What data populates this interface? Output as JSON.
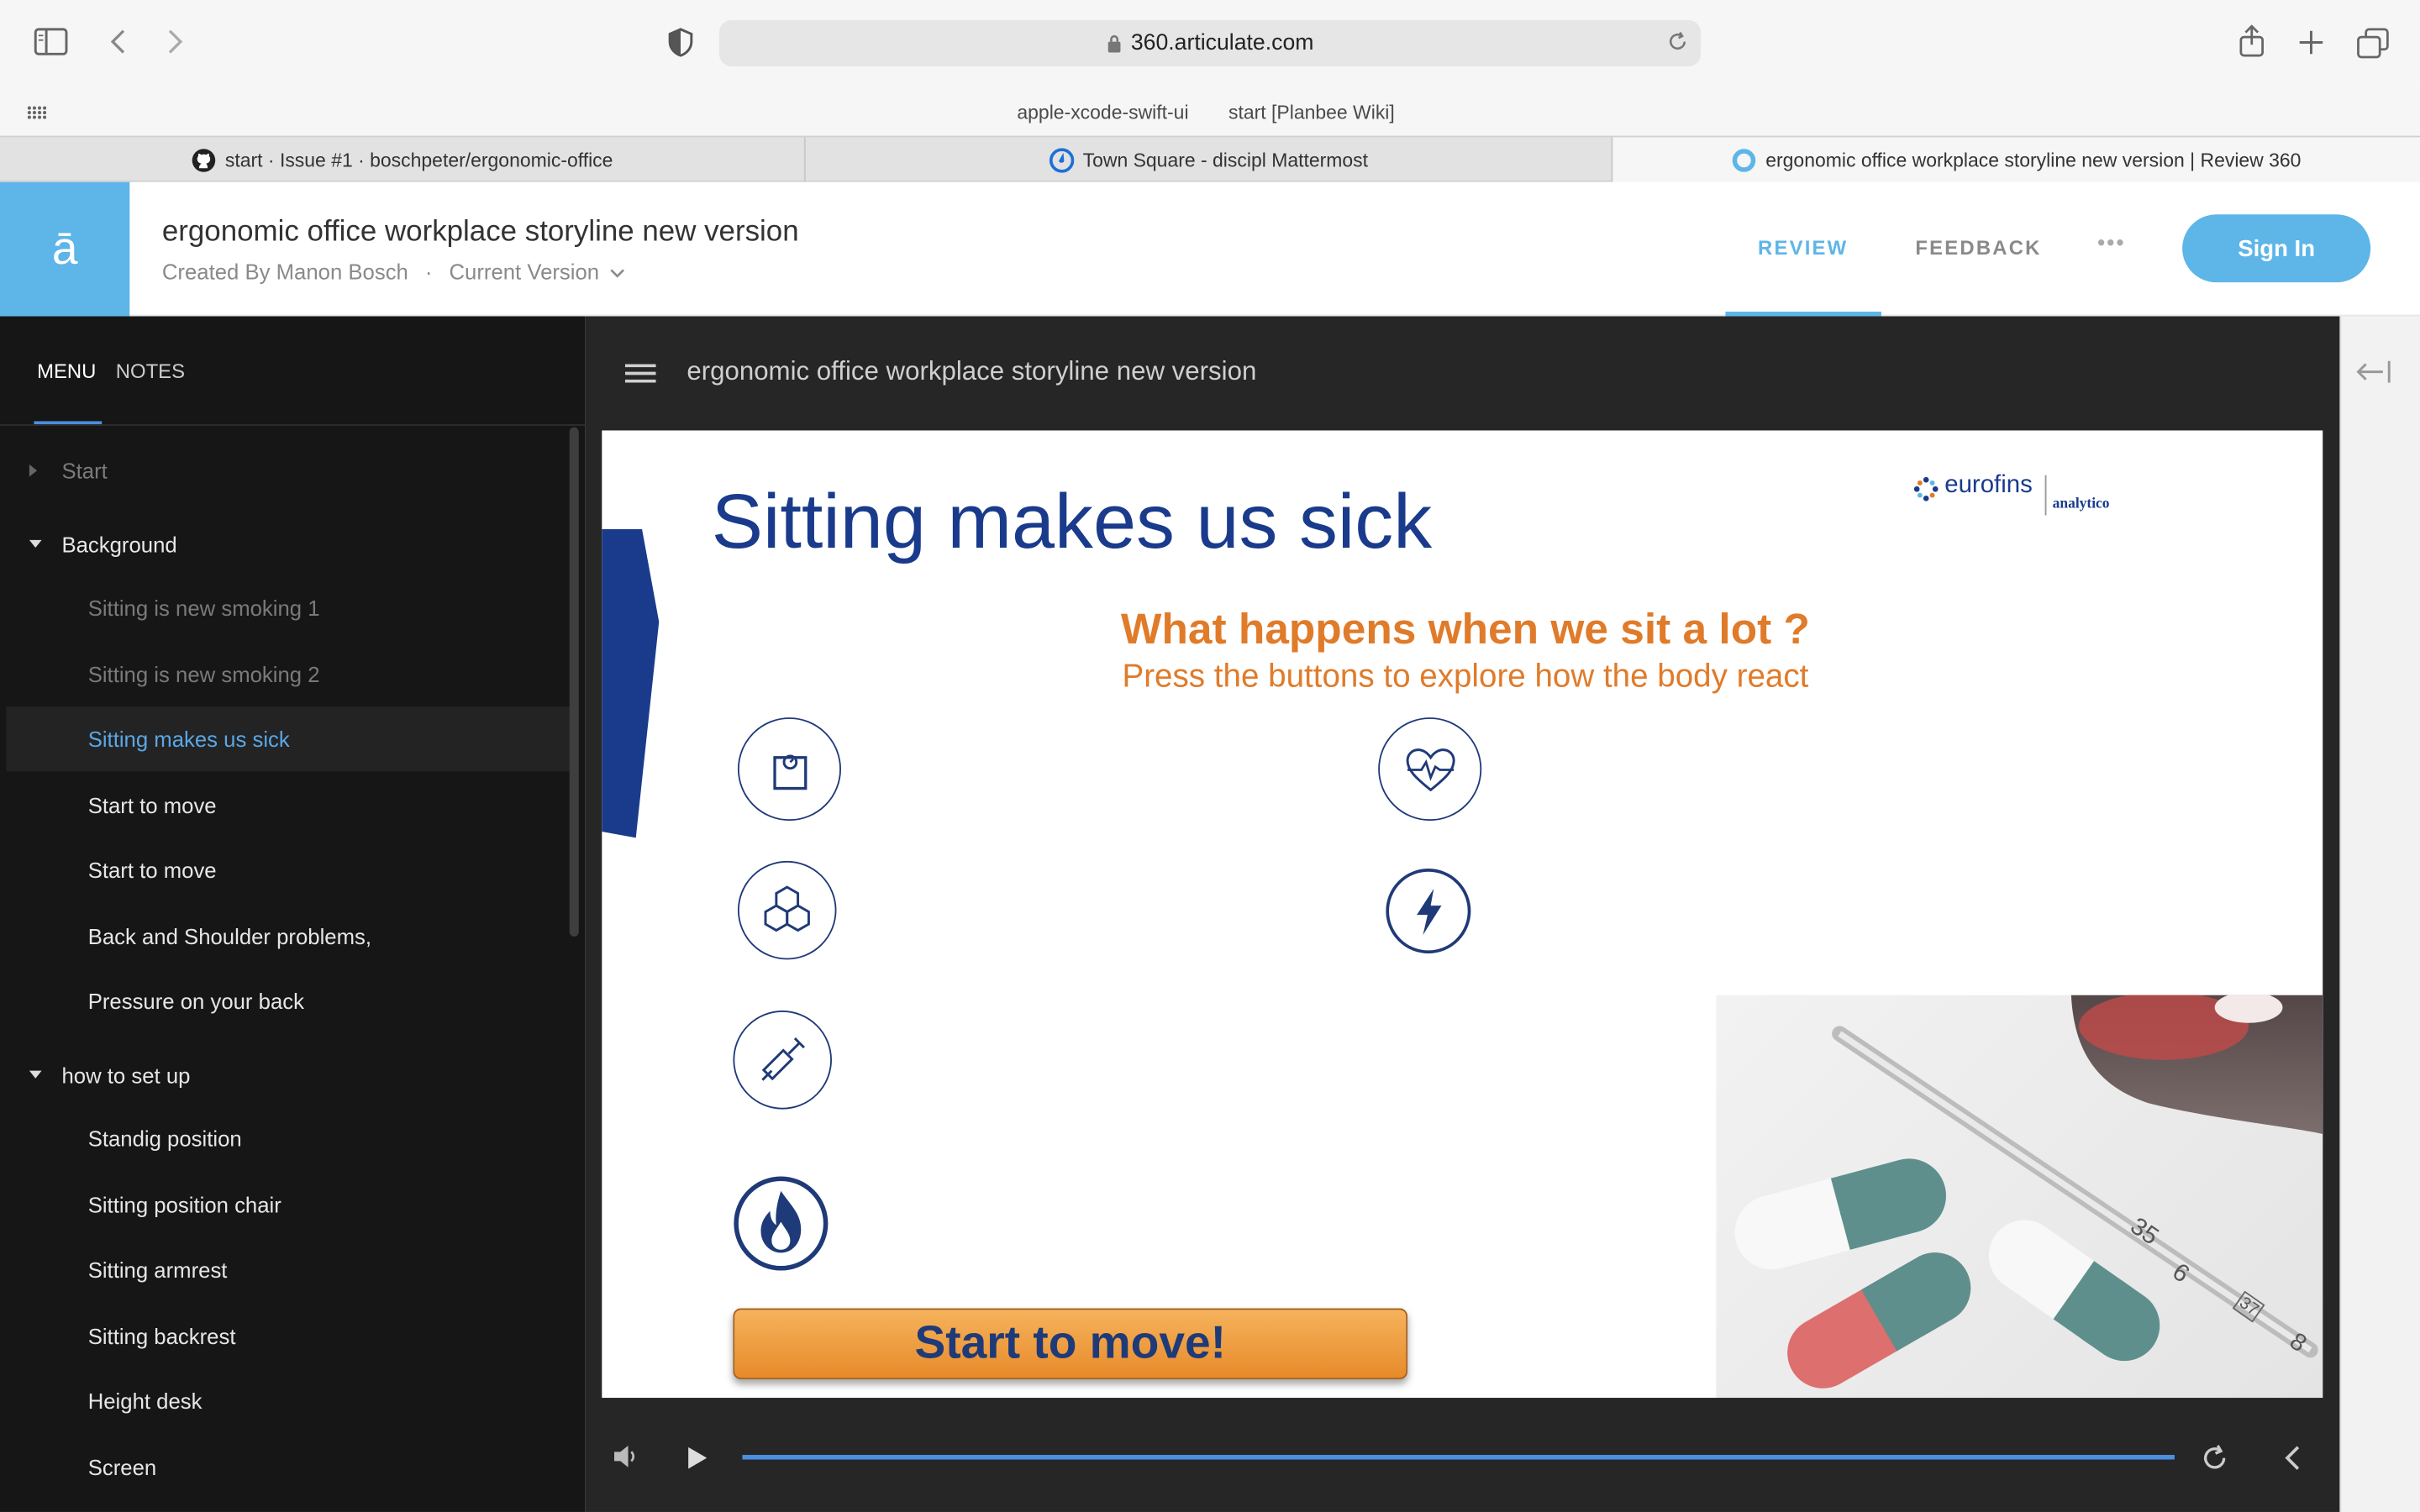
{
  "browser": {
    "url": "360.articulate.com",
    "bookmarks": [
      "apple-xcode-swift-ui",
      "start [Planbee Wiki]"
    ],
    "tabs": [
      {
        "label": "start · Issue #1 · boschpeter/ergonomic-office",
        "icon": "github-icon"
      },
      {
        "label": "Town Square - discipl Mattermost",
        "icon": "mattermost-icon"
      },
      {
        "label": "ergonomic office workplace storyline new version | Review 360",
        "icon": "review360-icon"
      }
    ]
  },
  "header": {
    "logo": "ā",
    "title": "ergonomic office workplace storyline new version",
    "created_by": "Created By Manon Bosch",
    "separator": "·",
    "version": "Current Version",
    "nav": {
      "review": "REVIEW",
      "feedback": "FEEDBACK",
      "more": "•••"
    },
    "sign_in": "Sign In",
    "accent": "#5eb5e8"
  },
  "sidebar": {
    "tabs": {
      "menu": "MENU",
      "notes": "NOTES"
    },
    "items": [
      {
        "label": "Start"
      },
      {
        "label": "Background"
      },
      {
        "label": "Sitting is new smoking 1"
      },
      {
        "label": "Sitting is new smoking 2"
      },
      {
        "label": "Sitting makes us sick"
      },
      {
        "label": "Start to move"
      },
      {
        "label": "Start to move"
      },
      {
        "label": "Back and Shoulder problems,"
      },
      {
        "label": "Pressure on your back"
      },
      {
        "label": "how to set up"
      },
      {
        "label": "Standig position"
      },
      {
        "label": "Sitting position chair"
      },
      {
        "label": "Sitting armrest"
      },
      {
        "label": "Sitting backrest"
      },
      {
        "label": "Height desk"
      },
      {
        "label": "Screen"
      }
    ]
  },
  "player": {
    "title": "ergonomic office workplace storyline new version",
    "progress": 1.0
  },
  "slide": {
    "heading": "Sitting makes us sick",
    "brand": "eurofins",
    "brand_sub": "analytico",
    "question": "What happens when we sit a lot ?",
    "instruction": "Press the buttons to explore how the body react",
    "cta": "Start to move!",
    "thermometer_marks": [
      "35",
      "6",
      "37",
      "8"
    ],
    "icons": [
      "scale-icon",
      "cells-icon",
      "syringe-icon",
      "fire-icon",
      "heart-pulse-icon",
      "lightning-icon"
    ],
    "colors": {
      "heading": "#1a3b8c",
      "question": "#e07b2a",
      "cta_text": "#1f3a78"
    }
  }
}
